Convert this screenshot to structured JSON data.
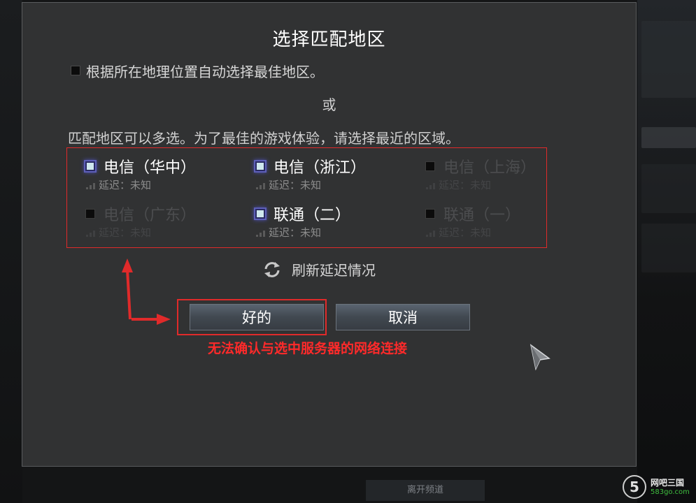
{
  "dialog": {
    "title": "选择匹配地区",
    "auto_select_label": "根据所在地理位置自动选择最佳地区。",
    "or_label": "或",
    "hint": "匹配地区可以多选。为了最佳的游戏体验，请选择最近的区域。",
    "regions": [
      {
        "name": "电信（华中）",
        "latency": "延迟：未知",
        "checked": true,
        "enabled": true
      },
      {
        "name": "电信（浙江）",
        "latency": "延迟：未知",
        "checked": true,
        "enabled": true
      },
      {
        "name": "电信（上海）",
        "latency": "延迟：未知",
        "checked": false,
        "enabled": false
      },
      {
        "name": "电信（广东）",
        "latency": "延迟：未知",
        "checked": false,
        "enabled": false
      },
      {
        "name": "联通（二）",
        "latency": "延迟：未知",
        "checked": true,
        "enabled": true
      },
      {
        "name": "联通（一）",
        "latency": "延迟：未知",
        "checked": false,
        "enabled": false
      }
    ],
    "refresh_label": "刷新延迟情况",
    "ok_label": "好的",
    "cancel_label": "取消"
  },
  "annotation": {
    "error_text": "无法确认与选中服务器的网络连接",
    "highlight_color": "#e02a2a"
  },
  "background": {
    "leave_channel_label": "离开频道"
  },
  "watermark": {
    "logo_text": "5",
    "site_name": "网吧三国",
    "site_url": "583go.com"
  }
}
